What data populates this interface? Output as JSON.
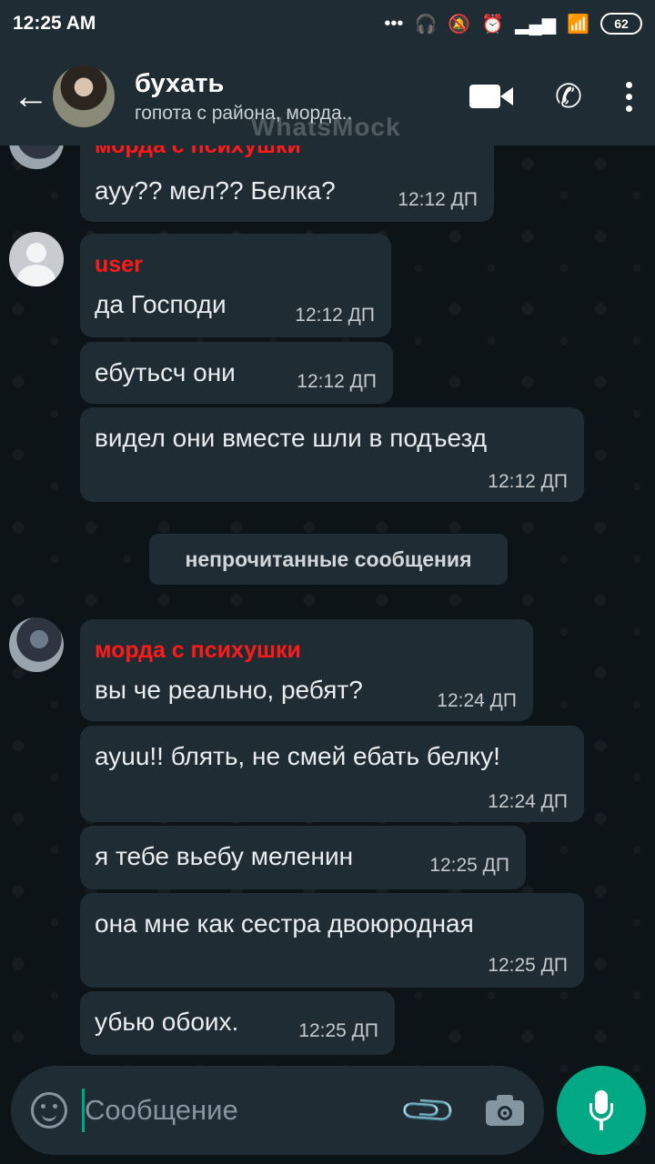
{
  "status_bar": {
    "time": "12:25 AM",
    "battery": "62"
  },
  "header": {
    "back_icon": "arrow-left-icon",
    "title": "бухать",
    "subtitle": "гопота с района, морда..",
    "watermark": "WhatsMock"
  },
  "messages": [
    {
      "sender": "морда с психушки",
      "text": "ауу?? мел?? Белка?",
      "time": "12:12 ДП"
    },
    {
      "sender": "user",
      "text": "да Господи",
      "time": "12:12 ДП"
    },
    {
      "text": "ебутьсч они",
      "time": "12:12 ДП"
    },
    {
      "text": "видел они вместе шли в подъезд",
      "time": "12:12 ДП"
    },
    {
      "sender": "морда с психушки",
      "text": "вы че реально, ребят?",
      "time": "12:24 ДП"
    },
    {
      "text": "ауuu!! блять, не смей ебать белку!",
      "time": "12:24 ДП"
    },
    {
      "text": "я тебе вьебу меленин",
      "time": "12:25 ДП"
    },
    {
      "text": "она мне как сестра двоюродная",
      "time": "12:25 ДП"
    },
    {
      "text": "убью обоих.",
      "time": "12:25 ДП"
    }
  ],
  "unread_label": "непрочитанные сообщения",
  "composer": {
    "placeholder": "Сообщение"
  },
  "colors": {
    "accent": "#00a884",
    "sender_name": "#ff1a1a",
    "bubble": "#202c33",
    "header": "#1f2c34"
  }
}
